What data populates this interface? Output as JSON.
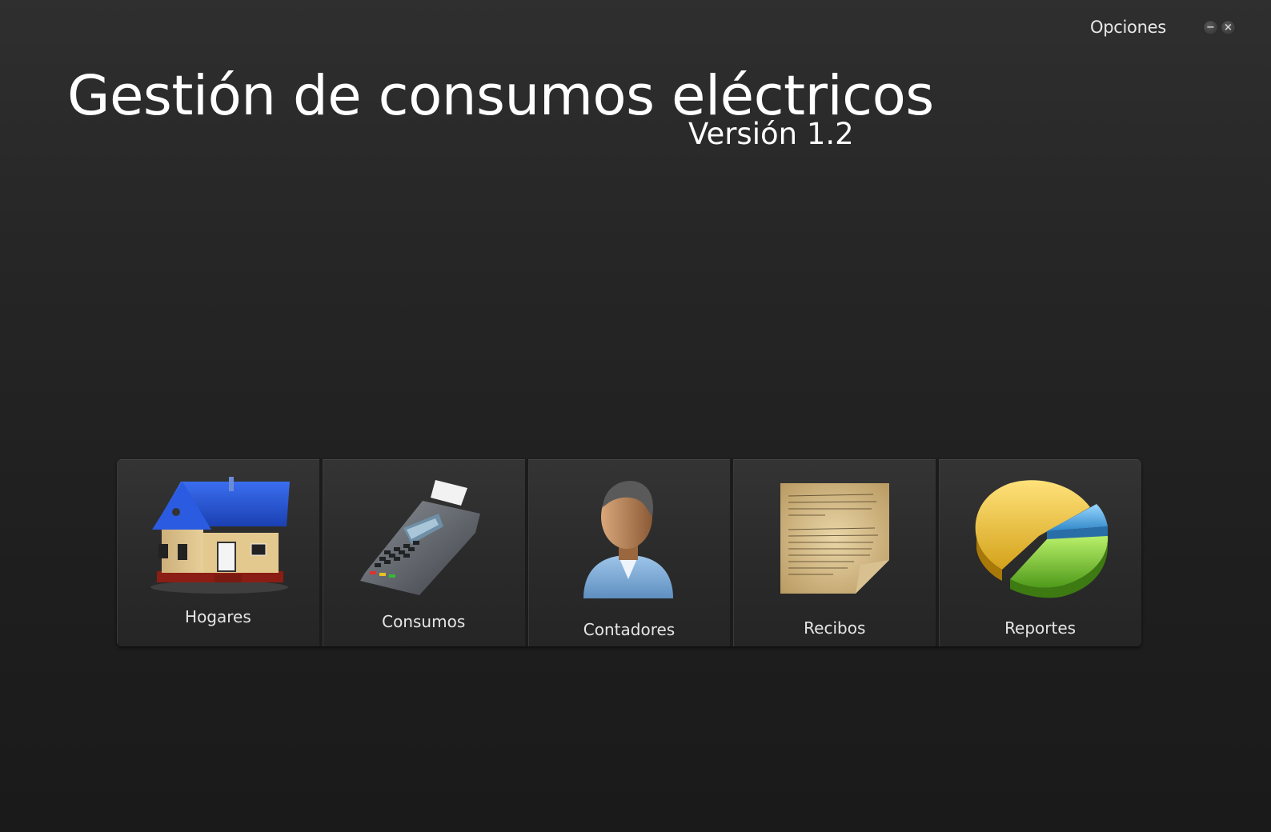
{
  "window": {
    "options_label": "Opciones",
    "minimize_glyph": "−",
    "close_glyph": "×"
  },
  "header": {
    "title": "Gestión de consumos eléctricos",
    "version": "Versión 1.2"
  },
  "tiles": [
    {
      "label": "Hogares",
      "icon": "house-icon"
    },
    {
      "label": "Consumos",
      "icon": "pos-terminal-icon"
    },
    {
      "label": "Contadores",
      "icon": "person-icon"
    },
    {
      "label": "Recibos",
      "icon": "document-icon"
    },
    {
      "label": "Reportes",
      "icon": "pie-chart-icon"
    }
  ],
  "colors": {
    "background": "#1e1e1e",
    "tile": "#2c2c2c",
    "text": "#ffffff"
  }
}
